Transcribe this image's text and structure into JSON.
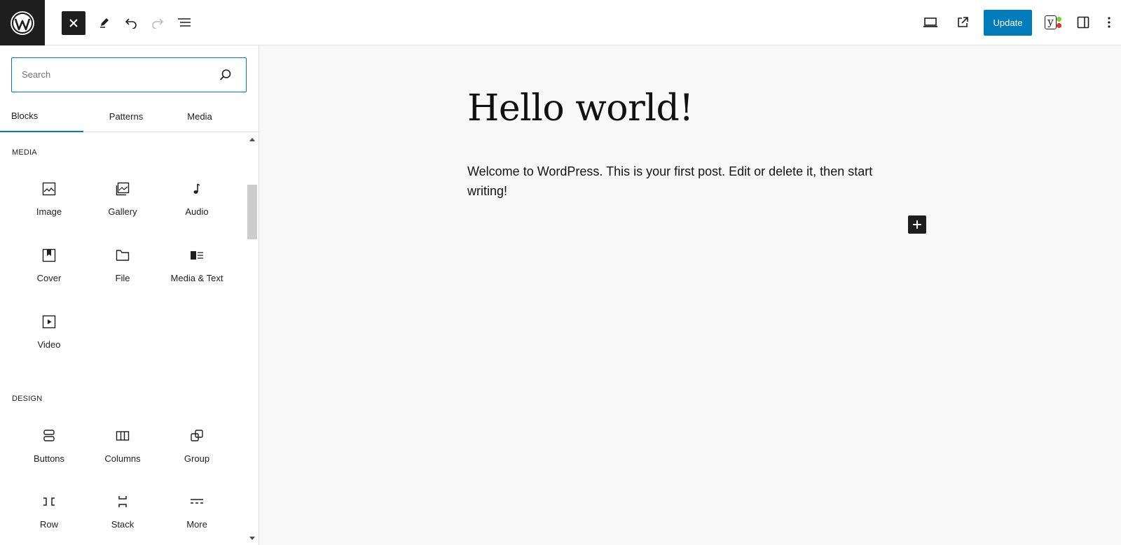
{
  "toolbar": {
    "update_label": "Update",
    "yoast_letter": "y"
  },
  "inserter": {
    "search": {
      "placeholder": "Search",
      "value": ""
    },
    "tabs": [
      {
        "label": "Blocks",
        "active": true
      },
      {
        "label": "Patterns",
        "active": false
      },
      {
        "label": "Media",
        "active": false
      }
    ],
    "categories": [
      {
        "title": "MEDIA",
        "blocks": [
          {
            "label": "Image",
            "icon": "image-icon"
          },
          {
            "label": "Gallery",
            "icon": "gallery-icon"
          },
          {
            "label": "Audio",
            "icon": "audio-icon"
          },
          {
            "label": "Cover",
            "icon": "cover-icon"
          },
          {
            "label": "File",
            "icon": "file-icon"
          },
          {
            "label": "Media & Text",
            "icon": "media-text-icon"
          },
          {
            "label": "Video",
            "icon": "video-icon"
          }
        ]
      },
      {
        "title": "DESIGN",
        "blocks": [
          {
            "label": "Buttons",
            "icon": "buttons-icon"
          },
          {
            "label": "Columns",
            "icon": "columns-icon"
          },
          {
            "label": "Group",
            "icon": "group-icon"
          },
          {
            "label": "Row",
            "icon": "row-icon"
          },
          {
            "label": "Stack",
            "icon": "stack-icon"
          },
          {
            "label": "More",
            "icon": "more-icon"
          }
        ]
      }
    ]
  },
  "post": {
    "title": "Hello world!",
    "body": "Welcome to WordPress. This is your first post. Edit or delete it, then start writing!"
  },
  "colors": {
    "accent": "#007cba",
    "dark": "#1e1e1e",
    "canvas_bg": "#f8f8f8"
  }
}
